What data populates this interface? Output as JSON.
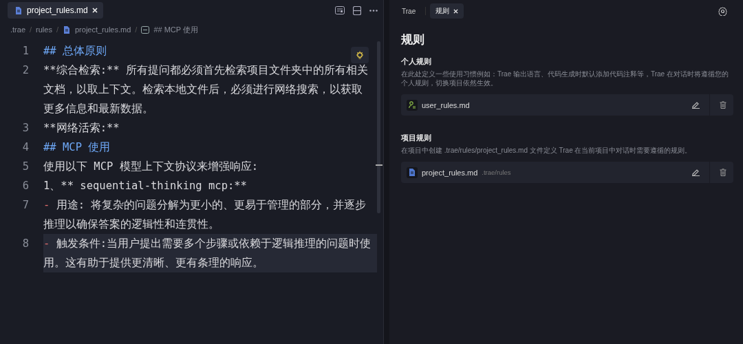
{
  "editor": {
    "tab": {
      "label": "project_rules.md",
      "selected": true
    },
    "breadcrumb": {
      "separator": "/",
      "items": [
        {
          "label": ".trae",
          "kind": "folder"
        },
        {
          "label": "rules",
          "kind": "folder"
        },
        {
          "label": "project_rules.md",
          "kind": "file"
        },
        {
          "label": "## MCP 使用",
          "kind": "symbol"
        }
      ]
    },
    "lines": [
      {
        "number": "1",
        "selected": false,
        "segments": [
          {
            "kind": "heading",
            "text": "## 总体原则"
          }
        ]
      },
      {
        "number": "2",
        "selected": false,
        "segments": [
          {
            "kind": "text",
            "text": "**综合检索:** 所有提问都必须首先检索项目文件夹中的所有相关文档，以取上下文。检索本地文件后，必须进行网络搜索，以获取更多信息和最新数据。"
          }
        ]
      },
      {
        "number": "3",
        "selected": false,
        "segments": [
          {
            "kind": "text",
            "text": "**网络活索:**"
          }
        ]
      },
      {
        "number": "4",
        "selected": false,
        "segments": [
          {
            "kind": "heading",
            "text": "## MCP 使用"
          }
        ]
      },
      {
        "number": "5",
        "selected": false,
        "segments": [
          {
            "kind": "text",
            "text": "使用以下 MCP 模型上下文协议来增强响应:"
          }
        ]
      },
      {
        "number": "6",
        "selected": false,
        "segments": [
          {
            "kind": "text",
            "text": "1、** sequential-thinking mcp:**"
          }
        ]
      },
      {
        "number": "7",
        "selected": false,
        "segments": [
          {
            "kind": "dash",
            "text": "-"
          },
          {
            "kind": "text",
            "text": " 用途: 将复杂的问题分解为更小的、更易于管理的部分，并逐步推理以确保答案的逻辑性和连贯性。"
          }
        ]
      },
      {
        "number": "8",
        "selected": true,
        "segments": [
          {
            "kind": "dash",
            "text": "-"
          },
          {
            "kind": "text",
            "text": " 触发条件:当用户提出需要多个步骤或依赖于逻辑推理的问题时使用。这有助于提供更清晰、更有条理的响应。"
          }
        ]
      }
    ]
  },
  "panel": {
    "tabs": [
      {
        "label": "Trae",
        "selected": false
      },
      {
        "label": "规则",
        "selected": true
      }
    ],
    "title": "规则",
    "sections": [
      {
        "heading": "个人规则",
        "description": "在此处定义一些使用习惯例如：Trae 输出语言、代码生成时默认添加代码注释等，Trae 在对话时将遵循您的个人规则，切换项目依然生效。",
        "files": [
          {
            "name": "user_rules.md",
            "kind": "user"
          }
        ]
      },
      {
        "heading": "项目规则",
        "description": "在项目中创建 .trae/rules/project_rules.md 文件定义 Trae 在当前项目中对话时需要遵循的规则。",
        "files": [
          {
            "name": "project_rules.md",
            "path": ".trae/rules",
            "kind": "project"
          }
        ]
      }
    ]
  }
}
